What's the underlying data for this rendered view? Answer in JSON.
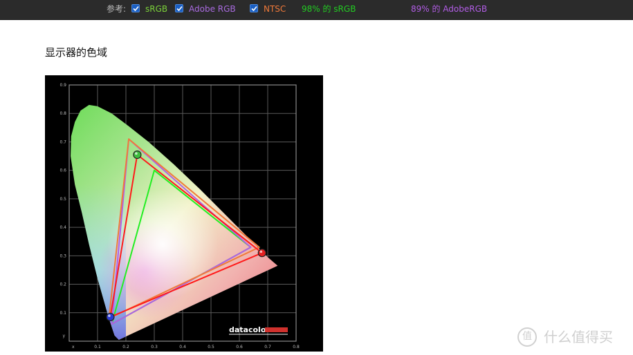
{
  "topbar": {
    "ref_label": "参考:",
    "checks": [
      {
        "label": "sRGB",
        "color": "#7cd23a"
      },
      {
        "label": "Adobe RGB",
        "color": "#a96be0"
      },
      {
        "label": "NTSC",
        "color": "#f07a3a"
      }
    ],
    "coverage": [
      {
        "text": "98% 的 sRGB",
        "color": "#22cc22"
      },
      {
        "text": "89% 的 AdobeRGB",
        "color": "#b25de6"
      }
    ]
  },
  "heading": "显示器的色域",
  "chart_data": {
    "type": "scatter",
    "title": "",
    "xlabel": "x",
    "ylabel": "y",
    "xlim": [
      0,
      0.8
    ],
    "ylim": [
      0,
      0.9
    ],
    "xticks": [
      "0.1",
      "0.2",
      "0.3",
      "0.4",
      "0.5",
      "0.6",
      "0.7",
      "0.8"
    ],
    "yticks": [
      "0.1",
      "0.2",
      "0.3",
      "0.4",
      "0.5",
      "0.6",
      "0.7",
      "0.8",
      "0.9"
    ],
    "grid": true,
    "brand": "datacolor",
    "gamuts": [
      {
        "name": "sRGB",
        "color": "#22ee22",
        "points": [
          [
            0.64,
            0.33
          ],
          [
            0.3,
            0.6
          ],
          [
            0.15,
            0.06
          ]
        ]
      },
      {
        "name": "Adobe RGB",
        "color": "#b15fe6",
        "points": [
          [
            0.64,
            0.33
          ],
          [
            0.21,
            0.71
          ],
          [
            0.15,
            0.06
          ]
        ]
      },
      {
        "name": "NTSC",
        "color": "#f07a3a",
        "points": [
          [
            0.67,
            0.33
          ],
          [
            0.21,
            0.71
          ],
          [
            0.14,
            0.08
          ]
        ]
      },
      {
        "name": "monitor",
        "color": "#ff1a1a",
        "points": [
          [
            0.68,
            0.31
          ],
          [
            0.24,
            0.655
          ],
          [
            0.145,
            0.085
          ]
        ]
      }
    ],
    "primaries": [
      {
        "name": "red",
        "x": 0.68,
        "y": 0.31,
        "color": "#e62020"
      },
      {
        "name": "green",
        "x": 0.24,
        "y": 0.655,
        "color": "#3fbf3f"
      },
      {
        "name": "blue",
        "x": 0.145,
        "y": 0.085,
        "color": "#2a3ad6"
      }
    ],
    "locus": [
      [
        0.175,
        0.005
      ],
      [
        0.16,
        0.02
      ],
      [
        0.14,
        0.08
      ],
      [
        0.1,
        0.22
      ],
      [
        0.07,
        0.34
      ],
      [
        0.045,
        0.45
      ],
      [
        0.02,
        0.55
      ],
      [
        0.005,
        0.65
      ],
      [
        0.007,
        0.72
      ],
      [
        0.02,
        0.77
      ],
      [
        0.04,
        0.81
      ],
      [
        0.07,
        0.83
      ],
      [
        0.1,
        0.825
      ],
      [
        0.15,
        0.8
      ],
      [
        0.21,
        0.755
      ],
      [
        0.28,
        0.7
      ],
      [
        0.37,
        0.62
      ],
      [
        0.46,
        0.535
      ],
      [
        0.55,
        0.445
      ],
      [
        0.64,
        0.355
      ],
      [
        0.7,
        0.295
      ],
      [
        0.735,
        0.265
      ]
    ]
  },
  "watermark": {
    "logo": "值",
    "text": "什么值得买"
  }
}
